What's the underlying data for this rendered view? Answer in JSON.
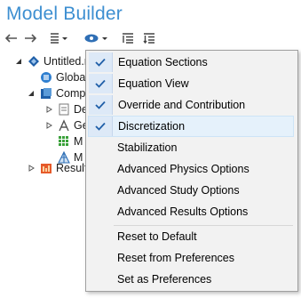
{
  "title": "Model Builder",
  "toolbar": {
    "icons": [
      "back-arrow-icon",
      "forward-arrow-icon",
      "show-icon",
      "view-eye-icon",
      "expand-all-icon",
      "collapse-all-icon"
    ]
  },
  "tree": {
    "root": "Untitled.m",
    "global": "Globa",
    "component": "Comp",
    "definitions": "De",
    "geometry": "Ge",
    "materials": "M",
    "mesh": "M",
    "results": "Result"
  },
  "menu": {
    "items": [
      {
        "label": "Equation Sections",
        "checked": true
      },
      {
        "label": "Equation View",
        "checked": true
      },
      {
        "label": "Override and Contribution",
        "checked": true
      },
      {
        "label": "Discretization",
        "checked": true,
        "highlighted": true
      },
      {
        "label": "Stabilization",
        "checked": false
      },
      {
        "label": "Advanced Physics Options",
        "checked": false
      },
      {
        "label": "Advanced Study Options",
        "checked": false
      },
      {
        "label": "Advanced Results Options",
        "checked": false
      },
      {
        "label": "Reset to Default",
        "checked": false
      },
      {
        "label": "Reset from Preferences",
        "checked": false
      },
      {
        "label": "Set as Preferences",
        "checked": false
      }
    ]
  },
  "colors": {
    "title": "#3d8fd1",
    "check": "#1f5fa8",
    "highlight": "#e5f1fb"
  }
}
